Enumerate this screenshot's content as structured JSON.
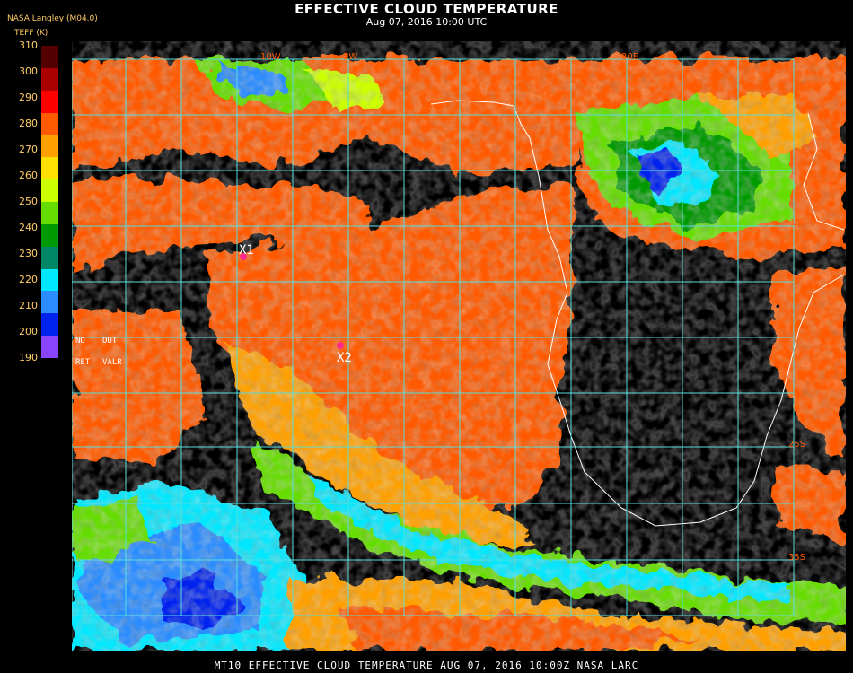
{
  "header": {
    "title": "EFFECTIVE CLOUD TEMPERATURE",
    "subtitle": "Aug 07, 2016 10:00 UTC",
    "org": "NASA Langley (M04.0)",
    "unit": "TEFF (K)"
  },
  "legend": {
    "ticks": [
      "310",
      "300",
      "290",
      "280",
      "270",
      "260",
      "250",
      "240",
      "230",
      "220",
      "210",
      "200",
      "190"
    ],
    "colors": [
      "#550000",
      "#aa0000",
      "#ff0000",
      "#ff5a00",
      "#ffa000",
      "#ffe000",
      "#ccff00",
      "#66dd00",
      "#009900",
      "#008866",
      "#00e8ff",
      "#2a8cff",
      "#0022ee",
      "#8844ff"
    ]
  },
  "map": {
    "grid_color": "#58dedb",
    "coast_color": "#ffffff",
    "no_ret": {
      "line1a": "NO",
      "line1b": "OUT",
      "line2a": "RET",
      "line2b": "VALR"
    },
    "points": [
      {
        "id": "X1",
        "label": "X1",
        "color": "#ff2a8a"
      },
      {
        "id": "X2",
        "label": "X2",
        "color": "#ff2a8a"
      }
    ],
    "lon_labels": [
      "10W",
      "5W",
      "30E"
    ],
    "lat_labels": [
      "15S",
      "25S",
      "35S"
    ]
  },
  "footer": {
    "caption": "MT10  EFFECTIVE CLOUD TEMPERATURE   AUG 07, 2016 10:00Z   NASA LARC"
  }
}
